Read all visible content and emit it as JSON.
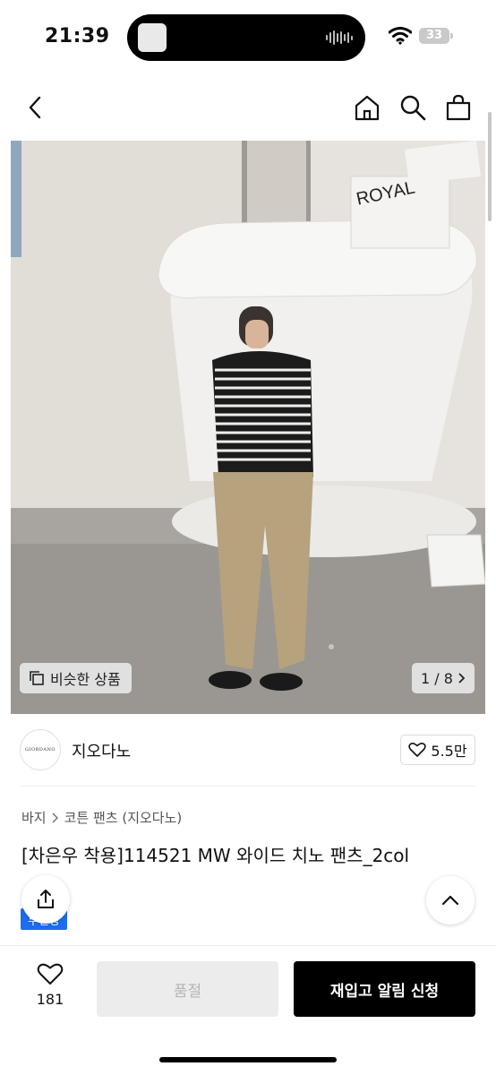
{
  "status_bar": {
    "time": "21:39",
    "battery": "33",
    "icons": [
      "signal-icon",
      "wifi-icon",
      "battery-icon"
    ]
  },
  "header": {
    "icons": [
      "back-icon",
      "home-icon",
      "search-icon",
      "shopping-bag-icon"
    ]
  },
  "hero": {
    "sign_text": "ROYAL",
    "similar_label": "비슷한 상품",
    "pager_text": "1 / 8"
  },
  "brand": {
    "logo_text": "GIORDANO",
    "name": "지오다노",
    "likes": "5.5만"
  },
  "product": {
    "breadcrumb": [
      "바지",
      "코튼 팬츠 (지오다노)"
    ],
    "title": "[차은우 착용]114521 MW 와이드 치노 팬츠_2col",
    "badge": "무진장"
  },
  "bottom_bar": {
    "wish_count": "181",
    "soldout_label": "품절",
    "restock_label": "재입고 알림 신청"
  },
  "colors": {
    "accent_blue": "#1d6cf2",
    "primary_button": "#000000",
    "disabled_button": "#ececec"
  }
}
